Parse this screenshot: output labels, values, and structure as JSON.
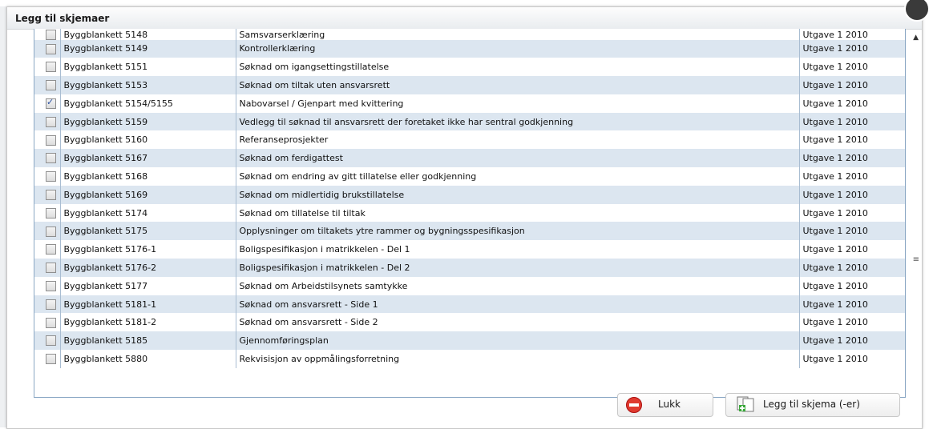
{
  "dialog": {
    "title": "Legg til skjemaer"
  },
  "rows": [
    {
      "name": "Byggblankett 5148",
      "description": "Samsvarserklæring",
      "version": "Utgave 1 2010",
      "checked": false
    },
    {
      "name": "Byggblankett 5149",
      "description": "Kontrollerklæring",
      "version": "Utgave 1 2010",
      "checked": false
    },
    {
      "name": "Byggblankett 5151",
      "description": "Søknad om igangsettingstillatelse",
      "version": "Utgave 1 2010",
      "checked": false
    },
    {
      "name": "Byggblankett 5153",
      "description": "Søknad om tiltak uten ansvarsrett",
      "version": "Utgave 1 2010",
      "checked": false
    },
    {
      "name": "Byggblankett 5154/5155",
      "description": "Nabovarsel / Gjenpart med kvittering",
      "version": "Utgave 1 2010",
      "checked": true
    },
    {
      "name": "Byggblankett 5159",
      "description": "Vedlegg til søknad til ansvarsrett der foretaket ikke har sentral godkjenning",
      "version": "Utgave 1 2010",
      "checked": false
    },
    {
      "name": "Byggblankett 5160",
      "description": "Referanseprosjekter",
      "version": "Utgave 1 2010",
      "checked": false
    },
    {
      "name": "Byggblankett 5167",
      "description": "Søknad om ferdigattest",
      "version": "Utgave 1 2010",
      "checked": false
    },
    {
      "name": "Byggblankett 5168",
      "description": "Søknad om endring av gitt tillatelse eller godkjenning",
      "version": "Utgave 1 2010",
      "checked": false
    },
    {
      "name": "Byggblankett 5169",
      "description": "Søknad om midlertidig brukstillatelse",
      "version": "Utgave 1 2010",
      "checked": false
    },
    {
      "name": "Byggblankett 5174",
      "description": "Søknad om tillatelse til tiltak",
      "version": "Utgave 1 2010",
      "checked": false
    },
    {
      "name": "Byggblankett 5175",
      "description": "Opplysninger om tiltakets ytre rammer og bygningsspesifikasjon",
      "version": "Utgave 1 2010",
      "checked": false
    },
    {
      "name": "Byggblankett 5176-1",
      "description": "Boligspesifikasjon i matrikkelen - Del 1",
      "version": "Utgave 1 2010",
      "checked": false
    },
    {
      "name": "Byggblankett 5176-2",
      "description": "Boligspesifikasjon i matrikkelen - Del 2",
      "version": "Utgave 1 2010",
      "checked": false
    },
    {
      "name": "Byggblankett 5177",
      "description": "Søknad om Arbeidstilsynets samtykke",
      "version": "Utgave 1 2010",
      "checked": false
    },
    {
      "name": "Byggblankett 5181-1",
      "description": "Søknad om ansvarsrett - Side 1",
      "version": "Utgave 1 2010",
      "checked": false
    },
    {
      "name": "Byggblankett 5181-2",
      "description": "Søknad om ansvarsrett - Side 2",
      "version": "Utgave 1 2010",
      "checked": false
    },
    {
      "name": "Byggblankett 5185",
      "description": "Gjennomføringsplan",
      "version": "Utgave 1 2010",
      "checked": false
    },
    {
      "name": "Byggblankett 5880",
      "description": "Rekvisisjon av oppmålingsforretning",
      "version": "Utgave 1 2010",
      "checked": false
    }
  ],
  "buttons": {
    "close_label": "Lukk",
    "add_label": "Legg til skjema (-er)"
  }
}
